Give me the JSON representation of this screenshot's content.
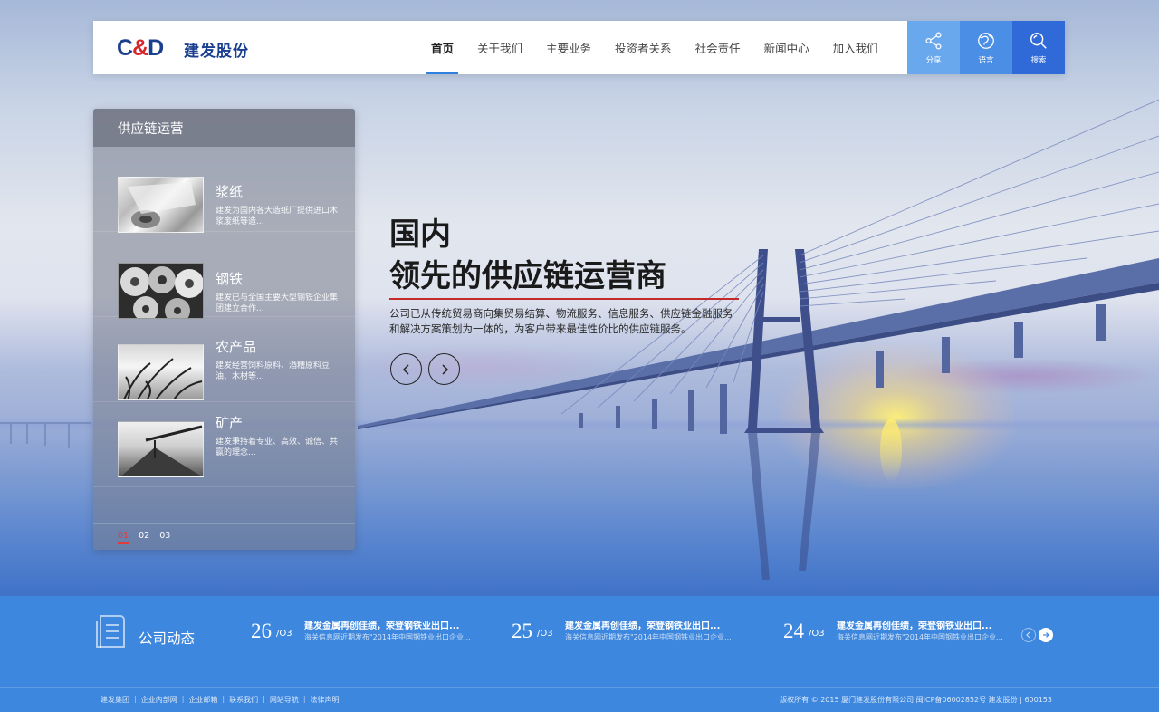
{
  "brand": {
    "mark_left": "C",
    "mark_amp": "&",
    "mark_right": "D",
    "name": "建发股份",
    "color_primary": "#1b3f8f",
    "color_accent": "#d8262e"
  },
  "nav": {
    "items": [
      {
        "label": "首页",
        "active": true
      },
      {
        "label": "关于我们"
      },
      {
        "label": "主要业务"
      },
      {
        "label": "投资者关系"
      },
      {
        "label": "社会责任"
      },
      {
        "label": "新闻中心"
      },
      {
        "label": "加入我们"
      }
    ]
  },
  "tools": [
    {
      "label": "分享",
      "icon": "share-icon"
    },
    {
      "label": "语言",
      "icon": "globe-icon"
    },
    {
      "label": "搜索",
      "icon": "search-icon"
    }
  ],
  "panel": {
    "title": "供应链运营",
    "items": [
      {
        "title": "浆纸",
        "desc": "建发为国内各大造纸厂提供进口木浆废纸等造..."
      },
      {
        "title": "钢铁",
        "desc": "建发已与全国主要大型钢铁企业集团建立合作..."
      },
      {
        "title": "农产品",
        "desc": "建发经营饲料原料、酒糟原料豆油、木材等..."
      },
      {
        "title": "矿产",
        "desc": "建发秉持着专业、高效、诚信、共赢的理念..."
      }
    ],
    "pages": [
      "01",
      "02",
      "03"
    ],
    "active_page": "01"
  },
  "hero": {
    "title_line1": "国内",
    "title_line2": "领先的供应链运营商",
    "desc": "公司已从传统贸易商向集贸易结算、物流服务、信息服务、供应链金融服务和解决方案策划为一体的，为客户带来最佳性价比的供应链服务。",
    "accent_color": "#c42a2a"
  },
  "news": {
    "label": "公司动态",
    "items": [
      {
        "day": "26",
        "month": "/O3",
        "title": "建发金属再创佳绩，荣登钢铁业出口...",
        "desc": "海关信息网近期发布\"2014年中国钢铁业出口企业..."
      },
      {
        "day": "25",
        "month": "/O3",
        "title": "建发金属再创佳绩，荣登钢铁业出口...",
        "desc": "海关信息网近期发布\"2014年中国钢铁业出口企业..."
      },
      {
        "day": "24",
        "month": "/O3",
        "title": "建发金属再创佳绩，荣登钢铁业出口...",
        "desc": "海关信息网近期发布\"2014年中国钢铁业出口企业..."
      }
    ]
  },
  "footer": {
    "links": [
      "建发集团",
      "企业内部网",
      "企业邮箱",
      "联系我们",
      "网站导航",
      "法律声明"
    ],
    "copyright": "版权所有 © 2015  厦门建发股份有限公司    闽ICP备06002852号     建发股份 | 600153"
  }
}
